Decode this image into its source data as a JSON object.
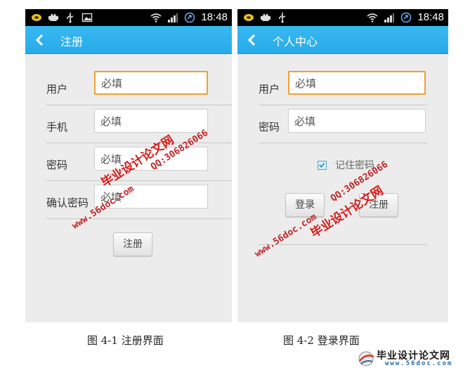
{
  "status_bar": {
    "time": "18:48"
  },
  "screen_register": {
    "title": "注册",
    "fields": [
      {
        "label": "用户",
        "placeholder": "必填"
      },
      {
        "label": "手机",
        "placeholder": "必填"
      },
      {
        "label": "密码",
        "placeholder": "必填"
      },
      {
        "label": "确认密码",
        "placeholder": "必填"
      }
    ],
    "submit_label": "注册"
  },
  "screen_login": {
    "title": "个人中心",
    "fields": [
      {
        "label": "用户",
        "placeholder": "必填"
      },
      {
        "label": "密码",
        "placeholder": "必填"
      }
    ],
    "remember_label": "记住密码",
    "remember_checked": true,
    "login_label": "登录",
    "register_label": "注册"
  },
  "captions": {
    "fig1": "图 4-1  注册界面",
    "fig2": "图 4-2  登录界面"
  },
  "watermarks": {
    "site_name": "毕业设计论文网",
    "url": "www.56doc.com",
    "qq": "QQ:306826066"
  },
  "footer_logo": {
    "name": "毕业设计论文网",
    "url": "www.56doc.com"
  },
  "colors": {
    "action_bar": "#27aaea",
    "focus_border": "#f0a030",
    "watermark": "#d81919"
  }
}
